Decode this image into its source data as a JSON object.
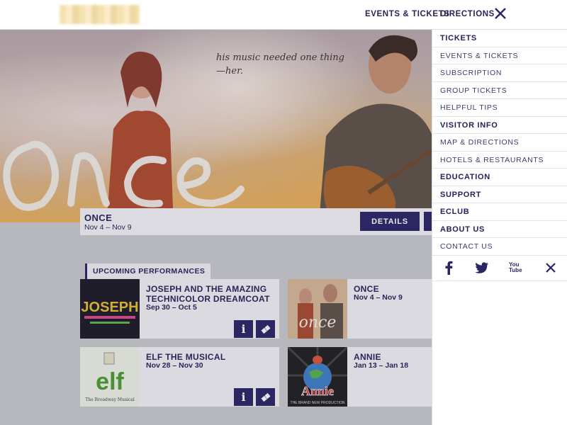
{
  "header": {
    "nav": [
      "EVENTS & TICKETS",
      "DIRECTIONS"
    ],
    "close_icon": "close-icon"
  },
  "hero": {
    "tagline": "his music needed one thing\n—her.",
    "title_art": "once"
  },
  "featured": {
    "name": "ONCE",
    "dates": "Nov 4 – Nov 9",
    "details_label": "DETAILS"
  },
  "upcoming": {
    "label": "UPCOMING PERFORMANCES",
    "cards": [
      {
        "name": "JOSEPH AND THE AMAZING TECHNICOLOR DREAMCOAT",
        "dates": "Sep 30 – Oct 5",
        "thumb_text": "JOSEPH"
      },
      {
        "name": "ONCE",
        "dates": "Nov 4 – Nov 9",
        "thumb_text": "once"
      },
      {
        "name": "ELF THE MUSICAL",
        "dates": "Nov 28 – Nov 30",
        "thumb_text": "elf",
        "thumb_sub": "The Broadway Musical"
      },
      {
        "name": "ANNIE",
        "dates": "Jan 13 – Jan 18",
        "thumb_text": "Annie",
        "thumb_sub": "THE BRAND NEW PRODUCTION"
      }
    ]
  },
  "menu": {
    "items": [
      {
        "label": "TICKETS",
        "head": true
      },
      {
        "label": "EVENTS & TICKETS",
        "head": false
      },
      {
        "label": "SUBSCRIPTION",
        "head": false
      },
      {
        "label": "GROUP TICKETS",
        "head": false
      },
      {
        "label": "HELPFUL TIPS",
        "head": false
      },
      {
        "label": "VISITOR INFO",
        "head": true
      },
      {
        "label": "MAP & DIRECTIONS",
        "head": false
      },
      {
        "label": "HOTELS & RESTAURANTS",
        "head": false
      },
      {
        "label": "EDUCATION",
        "head": true
      },
      {
        "label": "SUPPORT",
        "head": true
      },
      {
        "label": "ECLUB",
        "head": true
      },
      {
        "label": "ABOUT US",
        "head": true
      },
      {
        "label": "CONTACT US",
        "head": false
      }
    ],
    "social": [
      "facebook-icon",
      "twitter-icon",
      "youtube-icon",
      "close-icon"
    ],
    "youtube_text": "You Tube"
  },
  "colors": {
    "brand": "#2b2563",
    "menu_text": "#3f3a70"
  }
}
